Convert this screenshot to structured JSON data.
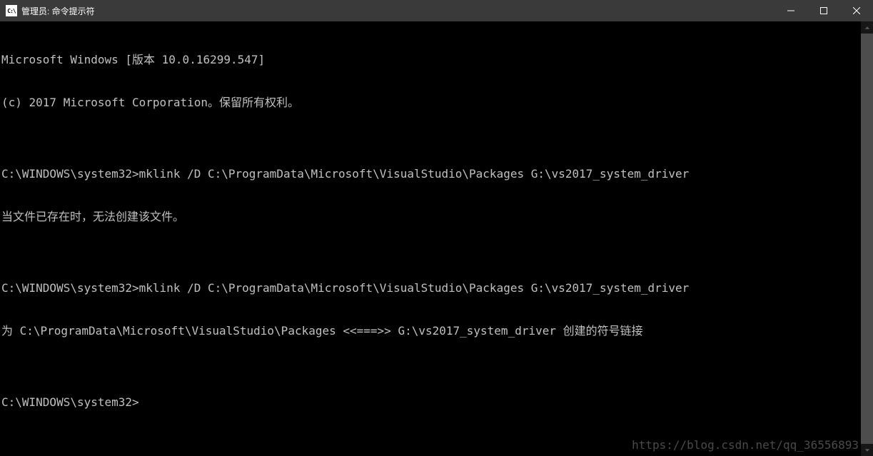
{
  "window": {
    "title": "管理员: 命令提示符"
  },
  "terminal": {
    "lines": [
      "Microsoft Windows [版本 10.0.16299.547]",
      "(c) 2017 Microsoft Corporation。保留所有权利。",
      "",
      "C:\\WINDOWS\\system32>mklink /D C:\\ProgramData\\Microsoft\\VisualStudio\\Packages G:\\vs2017_system_driver",
      "当文件已存在时，无法创建该文件。",
      "",
      "C:\\WINDOWS\\system32>mklink /D C:\\ProgramData\\Microsoft\\VisualStudio\\Packages G:\\vs2017_system_driver",
      "为 C:\\ProgramData\\Microsoft\\VisualStudio\\Packages <<===>> G:\\vs2017_system_driver 创建的符号链接",
      "",
      "C:\\WINDOWS\\system32>"
    ]
  },
  "watermark": "https://blog.csdn.net/qq_36556893"
}
